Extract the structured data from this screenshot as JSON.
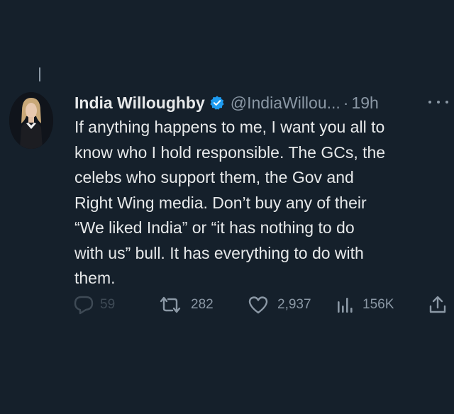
{
  "tweet": {
    "author_name": "India Willoughby",
    "handle": "@IndiaWillou...",
    "separator": "·",
    "time": "19h",
    "verified_color": "#1d9bf0",
    "body_lines": [
      "If anything happens to me, I want you all to",
      "know who I hold responsible. The GCs, the",
      "celebs who support them, the Gov and",
      "Right Wing media. Don’t buy any of their",
      "“We liked India” or “it has nothing to do",
      "with us” bull. It has everything to do with",
      "them."
    ]
  },
  "actions": {
    "reply_count": "59",
    "retweet_count": "282",
    "like_count": "2,937",
    "views_count": "156K"
  },
  "icons": {
    "reply": "reply-icon",
    "retweet": "retweet-icon",
    "like": "heart-icon",
    "views": "views-icon",
    "share": "share-icon",
    "more": "more-icon",
    "verified": "verified-badge-icon"
  },
  "colors": {
    "background": "#15202b",
    "text": "#e7e9ea",
    "secondary": "#8b98a5",
    "verified": "#1d9bf0"
  }
}
